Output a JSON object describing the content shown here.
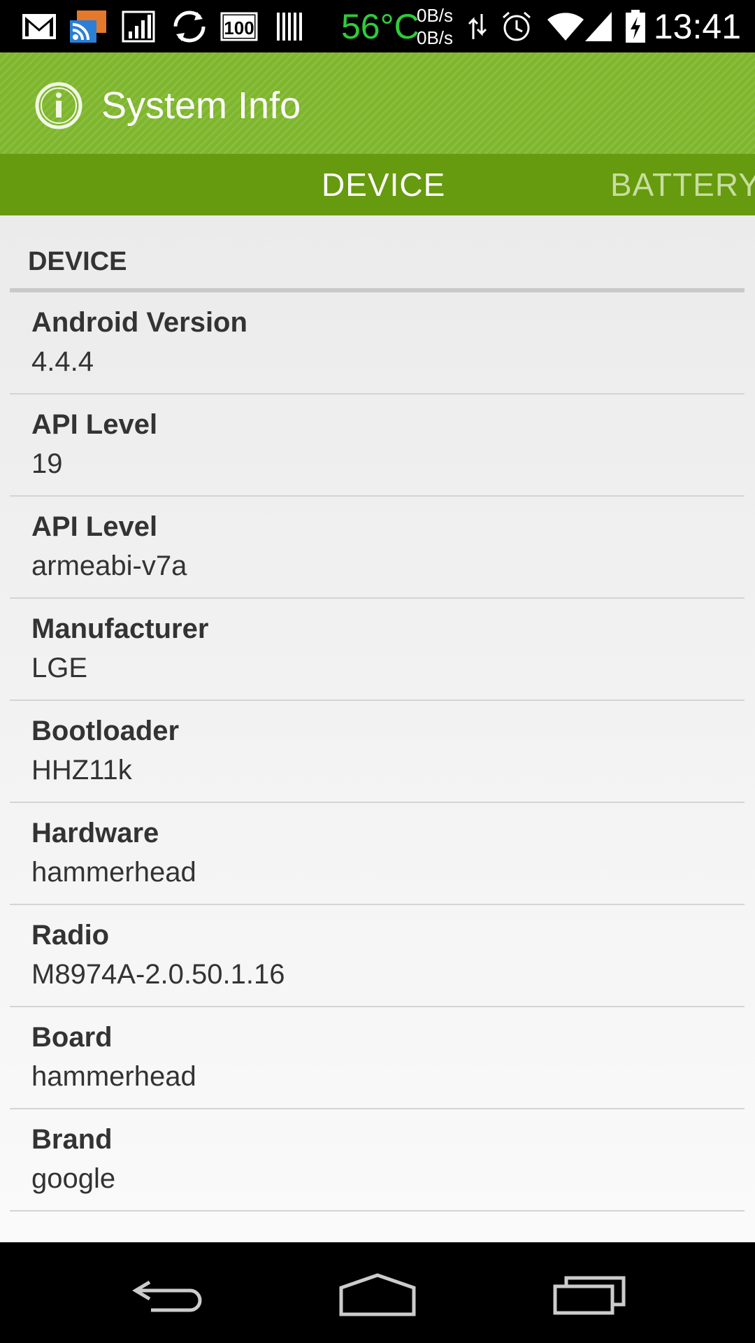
{
  "status_bar": {
    "temperature": "56°C",
    "speed_up": "0B/s",
    "speed_down": "0B/s",
    "time": "13:41",
    "battery_badge": "100",
    "icons": [
      "gmail-icon",
      "rss-icon",
      "signal-chart-icon",
      "sync-icon",
      "battery-100-icon",
      "barcode-icon",
      "data-arrows-icon",
      "alarm-icon",
      "wifi-icon",
      "cell-signal-icon",
      "battery-charging-icon"
    ]
  },
  "action_bar": {
    "icon": "info-icon",
    "title": "System Info"
  },
  "tabs": {
    "active": "DEVICE",
    "next": "BATTERY"
  },
  "section": {
    "title": "DEVICE"
  },
  "rows": [
    {
      "label": "Android Version",
      "value": "4.4.4"
    },
    {
      "label": "API Level",
      "value": "19"
    },
    {
      "label": "API Level",
      "value": "armeabi-v7a"
    },
    {
      "label": "Manufacturer",
      "value": "LGE"
    },
    {
      "label": "Bootloader",
      "value": "HHZ11k"
    },
    {
      "label": "Hardware",
      "value": "hammerhead"
    },
    {
      "label": "Radio",
      "value": "M8974A-2.0.50.1.16"
    },
    {
      "label": "Board",
      "value": "hammerhead"
    },
    {
      "label": "Brand",
      "value": "google"
    }
  ],
  "nav_bar": {
    "buttons": [
      "back-icon",
      "home-icon",
      "recents-icon"
    ]
  },
  "colors": {
    "action_bar": "#7eb62c",
    "tab_bar": "#669a0f",
    "temperature": "#2ecc3a",
    "inactive_tab": "#c7de9d"
  }
}
